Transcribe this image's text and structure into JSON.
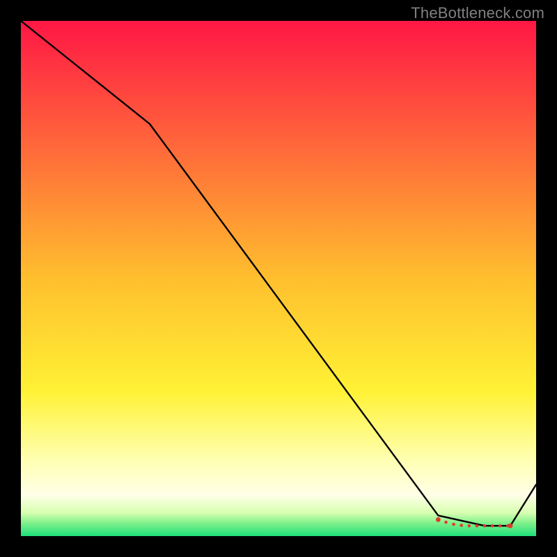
{
  "watermark": "TheBottleneck.com",
  "chart_data": {
    "type": "line",
    "title": "",
    "xlabel": "",
    "ylabel": "",
    "xlim": [
      0,
      100
    ],
    "ylim": [
      0,
      100
    ],
    "grid": false,
    "legend": false,
    "series": [
      {
        "name": "curve",
        "x": [
          0,
          25,
          81,
          90,
          95,
          100
        ],
        "y": [
          100,
          80,
          4,
          2,
          2,
          10
        ]
      }
    ],
    "markers": {
      "name": "flat-region-dots",
      "x": [
        81,
        82.5,
        84,
        85.5,
        87,
        88.5,
        90,
        91.5,
        93,
        94.5,
        95
      ],
      "y": [
        3.2,
        2.7,
        2.3,
        2.1,
        2.0,
        2.0,
        2.0,
        2.0,
        2.0,
        2.0,
        2.0
      ]
    },
    "background_gradient": {
      "stops": [
        {
          "offset": 0.0,
          "color": "#ff1745"
        },
        {
          "offset": 0.25,
          "color": "#ff6a3a"
        },
        {
          "offset": 0.5,
          "color": "#ffbf2e"
        },
        {
          "offset": 0.72,
          "color": "#fff235"
        },
        {
          "offset": 0.85,
          "color": "#ffffb0"
        },
        {
          "offset": 0.92,
          "color": "#ffffe8"
        },
        {
          "offset": 0.955,
          "color": "#d7ffb0"
        },
        {
          "offset": 0.975,
          "color": "#7ef08a"
        },
        {
          "offset": 1.0,
          "color": "#1ee07a"
        }
      ]
    }
  }
}
